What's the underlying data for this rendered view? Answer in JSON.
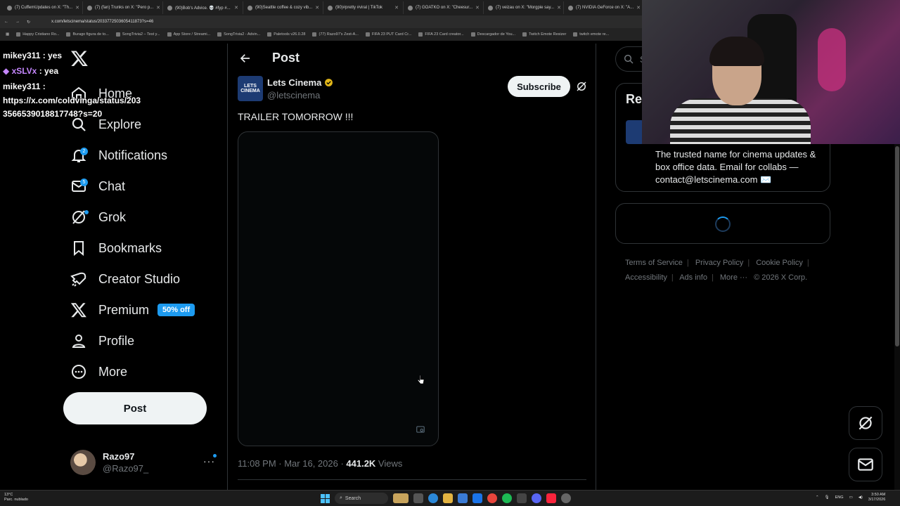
{
  "browser": {
    "tabs": [
      {
        "title": "(7) CuffemUpdates on X: \"Th..."
      },
      {
        "title": "(7) (fan) Trunks on X: \"Pero p..."
      },
      {
        "title": "(90)Bob's Advice. 💀 #fyp #..."
      },
      {
        "title": "(90)Seattle coffee & cozy vib..."
      },
      {
        "title": "(90)#pretty #viral | TikTok"
      },
      {
        "title": "(7) GOATKO on X: \"Cheesur..."
      },
      {
        "title": "(7) veizau on X: \"Morgpie say..."
      },
      {
        "title": "(7) NVIDIA GeForce on X: \"A..."
      }
    ],
    "url": "x.com/letscinema/status/2033772503605411873?s=46",
    "bookmarks": [
      "Happy Cristiano Ro...",
      "Burago figura de to...",
      "SongTrivia2 – Test y...",
      "App Store / Streami...",
      "SongTrivia2 - Advin...",
      "Paletools v26.0.28",
      "(77) Razo97's Zest-A...",
      "FIFA 23 PUT Card Cr...",
      "FIFA 23 Card creator...",
      "Descargador de You...",
      "Twitch Emote Resizer",
      "twitch emote re..."
    ]
  },
  "chat": {
    "messages": [
      {
        "user": "mikey311",
        "text": " : yes",
        "color": "#ffffff"
      },
      {
        "user": "xSLVx",
        "text": " : yea",
        "color": "#c587ff"
      },
      {
        "user": "mikey311",
        "text": " :",
        "color": "#ffffff"
      }
    ],
    "link_line1": "https://x.com/coldvinga/status/203",
    "link_line2": "3566539018817748?s=20"
  },
  "nav": {
    "home": "Home",
    "explore": "Explore",
    "notifications": "Notifications",
    "notifications_badge": "2",
    "chat": "Chat",
    "chat_badge": "5",
    "grok": "Grok",
    "bookmarks": "Bookmarks",
    "creator_studio": "Creator Studio",
    "premium": "Premium",
    "premium_promo": "50% off",
    "profile": "Profile",
    "more": "More",
    "post_button": "Post"
  },
  "account": {
    "name": "Razo97",
    "handle": "@Razo97_"
  },
  "post": {
    "header_title": "Post",
    "author_name": "Lets Cinema",
    "author_handle": "@letscinema",
    "author_avatar_text": "LETS CINEMA",
    "subscribe_label": "Subscribe",
    "text": "TRAILER TOMORROW !!!",
    "timestamp": "11:08 PM · Mar 16, 2026 · ",
    "views_count": "441.2K",
    "views_label": " Views"
  },
  "right": {
    "search_placeholder": "Se",
    "relevant_title": "Rel",
    "bio": "The trusted name for cinema updates & box office data. Email for collabs — contact@letscinema.com ✉️",
    "footer": {
      "terms": "Terms of Service",
      "privacy": "Privacy Policy",
      "cookie": "Cookie Policy",
      "accessibility": "Accessibility",
      "ads": "Ads info",
      "more": "More ···",
      "copyright": "© 2026 X Corp."
    }
  },
  "taskbar": {
    "weather_temp": "13°C",
    "weather_desc": "Parc. nublado",
    "search_label": "Search",
    "lang": "ENG",
    "time": "3:50 AM",
    "date": "3/17/2026"
  },
  "colors": {
    "accent": "#1d9bf0",
    "background": "#000000",
    "border": "#2f3336",
    "muted": "#71767b",
    "verified": "#e2b719"
  }
}
